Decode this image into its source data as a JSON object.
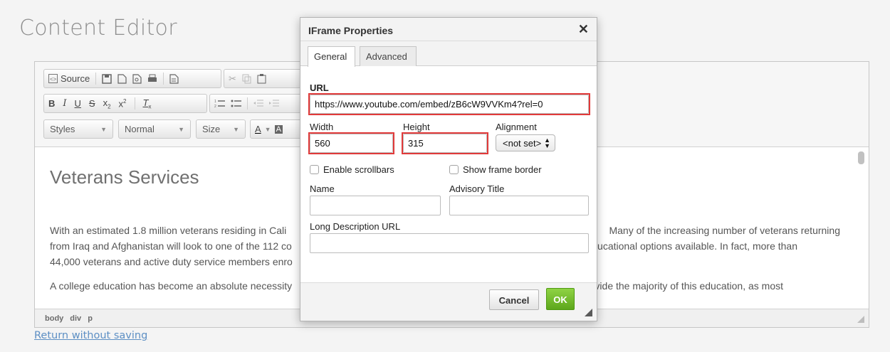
{
  "page": {
    "title": "Content Editor",
    "return_link": "Return without saving"
  },
  "toolbar": {
    "source_label": "Source",
    "styles_label": "Styles",
    "format_label": "Normal",
    "size_label": "Size",
    "bold": "B",
    "italic": "I",
    "underline": "U",
    "strike": "S",
    "text_color": "A",
    "bg_color": "A"
  },
  "document": {
    "heading": "Veterans Services",
    "para1_left": "With an estimated 1.8 million veterans residing in Cali",
    "para1_right": "Many of the increasing number of veterans returning",
    "para2_left": "from Iraq and Afghanistan will look to one of the 112 co",
    "para2_right": "educational options available. In fact, more than",
    "para3_left": "44,000 veterans and active duty service members enro",
    "para4_left": "A college education has become an absolute necessity",
    "para4_right": "ovide the majority of this education, as most"
  },
  "status_path": [
    "body",
    "div",
    "p"
  ],
  "dialog": {
    "title": "IFrame Properties",
    "close": "✕",
    "tabs": [
      "General",
      "Advanced"
    ],
    "url_label": "URL",
    "url_value": "https://www.youtube.com/embed/zB6cW9VVKm4?rel=0",
    "width_label": "Width",
    "width_value": "560",
    "height_label": "Height",
    "height_value": "315",
    "alignment_label": "Alignment",
    "alignment_value": "<not set>",
    "enable_scrollbars": "Enable scrollbars",
    "show_frame_border": "Show frame border",
    "name_label": "Name",
    "name_value": "",
    "advisory_label": "Advisory Title",
    "advisory_value": "",
    "longdesc_label": "Long Description URL",
    "longdesc_value": "",
    "cancel": "Cancel",
    "ok": "OK"
  },
  "colors": {
    "highlight": "#e13a3a",
    "ok_button": "#6ab42a",
    "link": "#5d8fc4"
  }
}
